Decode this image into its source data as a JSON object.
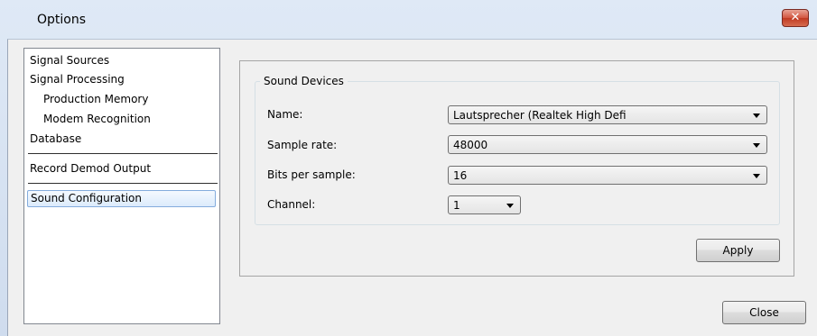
{
  "window": {
    "title": "Options",
    "close_glyph": "✕"
  },
  "nav": {
    "items": [
      {
        "label": "Signal Sources"
      },
      {
        "label": "Signal Processing"
      },
      {
        "label": "Production Memory"
      },
      {
        "label": "Modem Recognition"
      },
      {
        "label": "Database"
      },
      {
        "label": "Record Demod Output"
      },
      {
        "label": "Sound Configuration"
      }
    ],
    "selected": "Sound Configuration"
  },
  "sound_devices": {
    "group_title": "Sound Devices",
    "name_label": "Name:",
    "name_value": "Lautsprecher (Realtek High Defi",
    "sample_rate_label": "Sample rate:",
    "sample_rate_value": "48000",
    "bits_label": "Bits per sample:",
    "bits_value": "16",
    "channel_label": "Channel:",
    "channel_value": "1"
  },
  "buttons": {
    "apply": "Apply",
    "close": "Close"
  }
}
